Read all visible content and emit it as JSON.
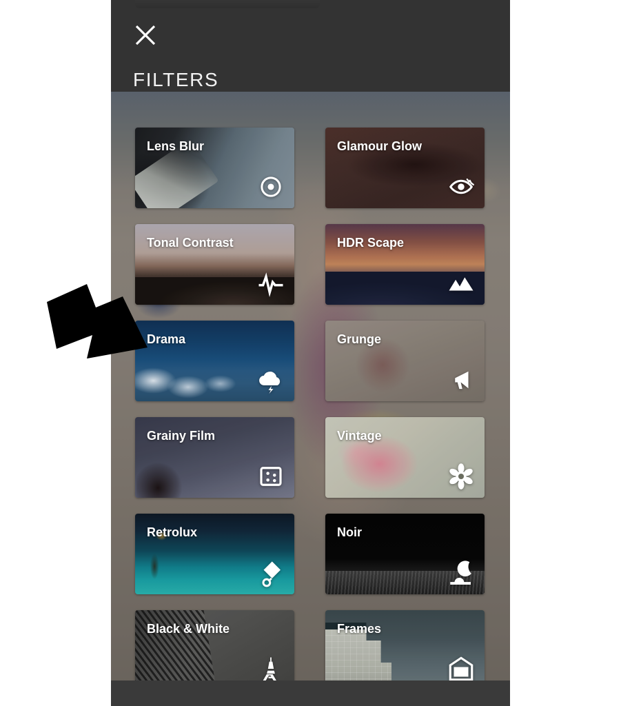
{
  "app": {
    "screen_title": "FILTERS",
    "close_icon": "close-x-icon",
    "status_pill": "status-pill"
  },
  "filters": [
    {
      "name": "Lens Blur",
      "icon": "aperture-target-icon",
      "thumb_class": "th-lensblur"
    },
    {
      "name": "Glamour Glow",
      "icon": "eye-icon",
      "thumb_class": "th-glamour"
    },
    {
      "name": "Tonal Contrast",
      "icon": "waveform-pulse-icon",
      "thumb_class": "th-tonal"
    },
    {
      "name": "HDR Scape",
      "icon": "mountains-icon",
      "thumb_class": "th-hdr"
    },
    {
      "name": "Drama",
      "icon": "storm-cloud-icon",
      "thumb_class": "th-drama"
    },
    {
      "name": "Grunge",
      "icon": "megaphone-icon",
      "thumb_class": "th-grunge"
    },
    {
      "name": "Grainy Film",
      "icon": "film-grain-icon",
      "thumb_class": "th-grainy"
    },
    {
      "name": "Vintage",
      "icon": "flower-icon",
      "thumb_class": "th-vintage"
    },
    {
      "name": "Retrolux",
      "icon": "kite-icon",
      "thumb_class": "th-retrolux"
    },
    {
      "name": "Noir",
      "icon": "crescent-moon-icon",
      "thumb_class": "th-noir"
    },
    {
      "name": "Black & White",
      "icon": "eiffel-tower-icon",
      "thumb_class": "th-bw"
    },
    {
      "name": "Frames",
      "icon": "picture-frame-icon",
      "thumb_class": "th-frames"
    }
  ],
  "annotation": {
    "arrow": "pointer-arrow",
    "points_at": "Drama"
  },
  "colors": {
    "header_bg": "#333333",
    "footer_bg": "#3a3a3a",
    "label_text": "#ffffff",
    "icon_fill": "#ffffff",
    "page_bg": "#ffffff",
    "arrow": "#000000"
  }
}
